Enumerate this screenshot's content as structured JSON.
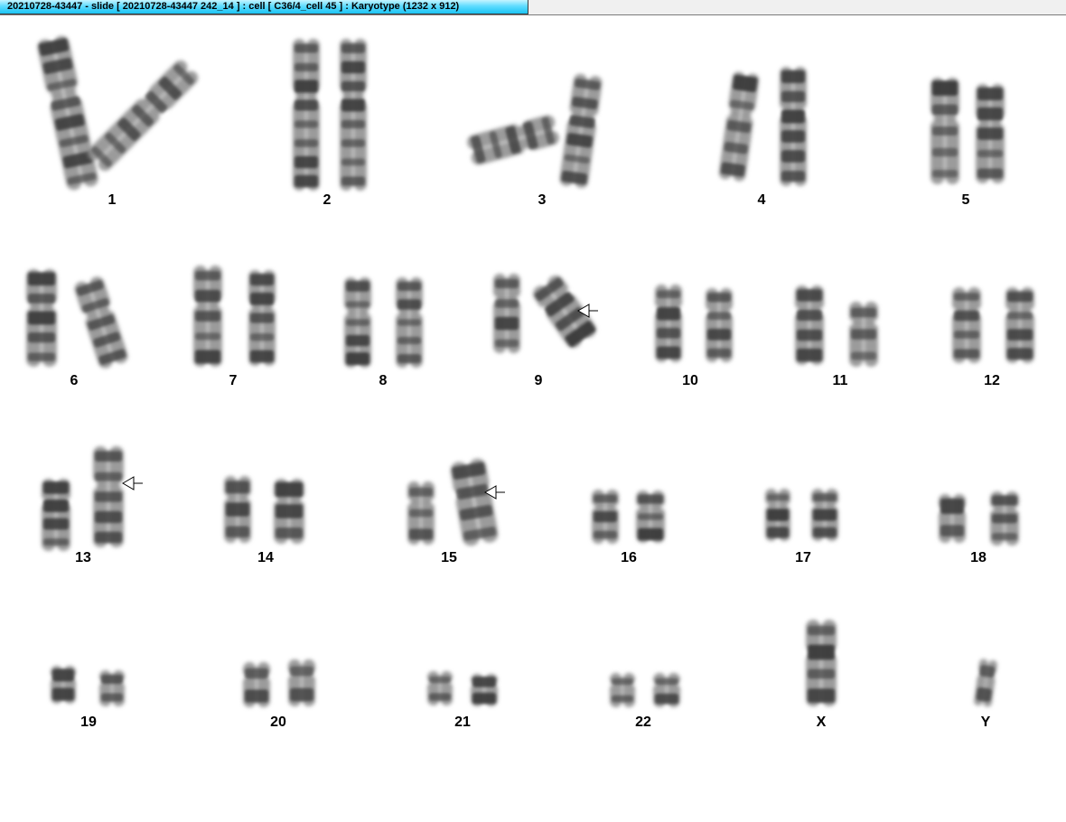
{
  "window": {
    "title": "20210728-43447 - slide [ 20210728-43447 242_14 ] : cell [ C36/4_cell 45 ] : Karyotype  (1232 x 912)",
    "accent_color": "#1cc4f4"
  },
  "karyotype": {
    "chromosome_color": "#3a3a3a",
    "pairs": [
      {
        "label": "1"
      },
      {
        "label": "2"
      },
      {
        "label": "3"
      },
      {
        "label": "4"
      },
      {
        "label": "5"
      },
      {
        "label": "6"
      },
      {
        "label": "7"
      },
      {
        "label": "8"
      },
      {
        "label": "9",
        "marker": "arrow-icon"
      },
      {
        "label": "10"
      },
      {
        "label": "11"
      },
      {
        "label": "12"
      },
      {
        "label": "13",
        "marker": "arrow-icon"
      },
      {
        "label": "14"
      },
      {
        "label": "15",
        "marker": "arrow-icon"
      },
      {
        "label": "16"
      },
      {
        "label": "17"
      },
      {
        "label": "18"
      },
      {
        "label": "19"
      },
      {
        "label": "20"
      },
      {
        "label": "21"
      },
      {
        "label": "22"
      },
      {
        "label": "X"
      },
      {
        "label": "Y"
      }
    ]
  }
}
